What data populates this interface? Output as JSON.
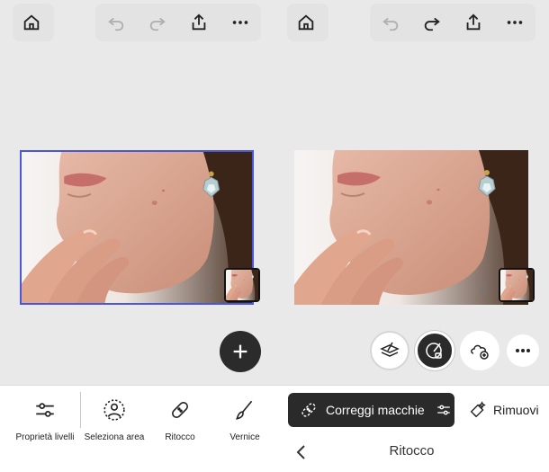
{
  "left_panel": {
    "header": {
      "home_icon": "home-icon",
      "undo_icon": "undo-icon",
      "redo_icon": "redo-icon",
      "share_icon": "share-icon",
      "more_icon": "more-icon"
    },
    "image": {
      "selected": true,
      "description_icon": "photo"
    },
    "add_button_icon": "plus-icon",
    "toolbar": {
      "items": [
        {
          "label": "Proprietà livelli",
          "icon": "sliders-icon"
        },
        {
          "label": "Seleziona area",
          "icon": "select-subject-icon"
        },
        {
          "label": "Ritocco",
          "icon": "bandage-icon"
        },
        {
          "label": "Vernice",
          "icon": "brush-icon"
        }
      ]
    }
  },
  "right_panel": {
    "header": {
      "home_icon": "home-icon",
      "undo_icon": "undo-icon",
      "redo_icon": "redo-icon",
      "share_icon": "share-icon",
      "more_icon": "more-icon"
    },
    "tool_circles": [
      {
        "name": "layers-icon"
      },
      {
        "name": "healing-brush-icon"
      },
      {
        "name": "add-cloud-icon"
      },
      {
        "name": "more-icon"
      }
    ],
    "toolbar": {
      "active_chip": {
        "label": "Correggi macchie",
        "icon": "spot-heal-icon",
        "settings_icon": "sliders-icon"
      },
      "secondary_chip": {
        "label": "Rimuovi",
        "icon": "remove-icon"
      },
      "back_label": "Ritocco"
    }
  },
  "colors": {
    "background": "#e9e9e9",
    "selection": "#4a57d9",
    "dark": "#2a2a2a"
  }
}
